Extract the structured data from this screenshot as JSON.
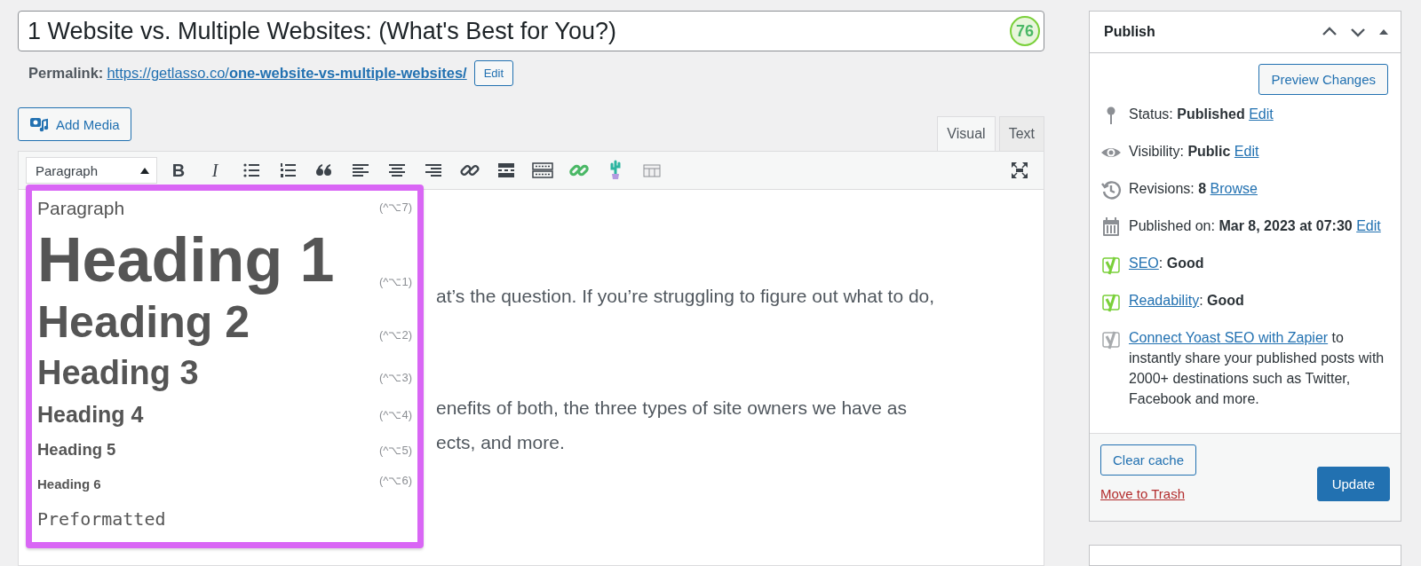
{
  "post_title": {
    "value": "1 Website vs. Multiple Websites: (What's Best for You?)",
    "score": "76"
  },
  "permalink": {
    "label": "Permalink:",
    "url_base": "https://getlasso.co/",
    "url_slug": "one-website-vs-multiple-websites/",
    "edit_button": "Edit"
  },
  "add_media_button": "Add Media",
  "editor_tabs": [
    {
      "label": "Visual",
      "selected": true
    },
    {
      "label": "Text",
      "selected": false
    }
  ],
  "format_select": {
    "value": "Paragraph",
    "expanded": true
  },
  "toolbar": [
    {
      "kind": "bold",
      "label": "B"
    },
    {
      "kind": "italic",
      "label": "I"
    },
    {
      "kind": "bullets"
    },
    {
      "kind": "numbers"
    },
    {
      "kind": "quote"
    },
    {
      "kind": "align-left"
    },
    {
      "kind": "align-center"
    },
    {
      "kind": "align-right"
    },
    {
      "kind": "link"
    },
    {
      "kind": "more"
    },
    {
      "kind": "keyboard"
    },
    {
      "kind": "green-link"
    },
    {
      "kind": "cactus"
    },
    {
      "kind": "table"
    }
  ],
  "format_menu": [
    {
      "kind": "p",
      "label": "Paragraph",
      "shortcut": "(^⌥7)"
    },
    {
      "kind": "h1",
      "label": "Heading 1",
      "shortcut": "(^⌥1)"
    },
    {
      "kind": "h2",
      "label": "Heading 2",
      "shortcut": "(^⌥2)"
    },
    {
      "kind": "h3",
      "label": "Heading 3",
      "shortcut": "(^⌥3)"
    },
    {
      "kind": "h4",
      "label": "Heading 4",
      "shortcut": "(^⌥4)"
    },
    {
      "kind": "h5",
      "label": "Heading 5",
      "shortcut": "(^⌥5)"
    },
    {
      "kind": "h6",
      "label": "Heading 6",
      "shortcut": "(^⌥6)"
    },
    {
      "kind": "pre",
      "label": "Preformatted"
    }
  ],
  "body_lines": [
    "at’s the question. If you’re struggling to figure out what to do,",
    "enefits of both, the three types of site owners we have as",
    "ects, and more."
  ],
  "publish_box": {
    "title": "Publish",
    "preview_button": "Preview Changes",
    "rows": [
      {
        "kind": "pin",
        "parts": [
          {
            "kind": "text",
            "text": "Status: **Published** "
          },
          {
            "kind": "link",
            "text": "Edit"
          }
        ]
      },
      {
        "kind": "eye",
        "parts": [
          {
            "kind": "text",
            "text": "Visibility: **Public** "
          },
          {
            "kind": "link",
            "text": "Edit"
          }
        ]
      },
      {
        "kind": "history",
        "parts": [
          {
            "kind": "text",
            "text": "Revisions: **8** "
          },
          {
            "kind": "link",
            "text": "Browse"
          }
        ]
      },
      {
        "kind": "calendar",
        "parts": [
          {
            "kind": "text",
            "text": "Published on: **Mar 8, 2023 at 07:30** "
          },
          {
            "kind": "link",
            "text": "Edit"
          }
        ]
      },
      {
        "kind": "yoast",
        "color": "#7ad03a",
        "parts": [
          {
            "kind": "link",
            "text": "SEO"
          },
          {
            "kind": "text",
            "text": ": **Good**"
          }
        ]
      },
      {
        "kind": "yoast",
        "color": "#7ad03a",
        "parts": [
          {
            "kind": "link",
            "text": "Readability"
          },
          {
            "kind": "text",
            "text": ": **Good**"
          }
        ]
      },
      {
        "kind": "yoast",
        "color": "#a7aaad",
        "parts": [
          {
            "kind": "link",
            "text": "Connect Yoast SEO with Zapier"
          },
          {
            "kind": "text",
            "text": " to instantly share your published posts with 2000+ destinations such as Twitter, Facebook and more."
          }
        ]
      }
    ],
    "clear_cache_button": "Clear cache",
    "trash_link": "Move to Trash",
    "update_button": "Update"
  }
}
